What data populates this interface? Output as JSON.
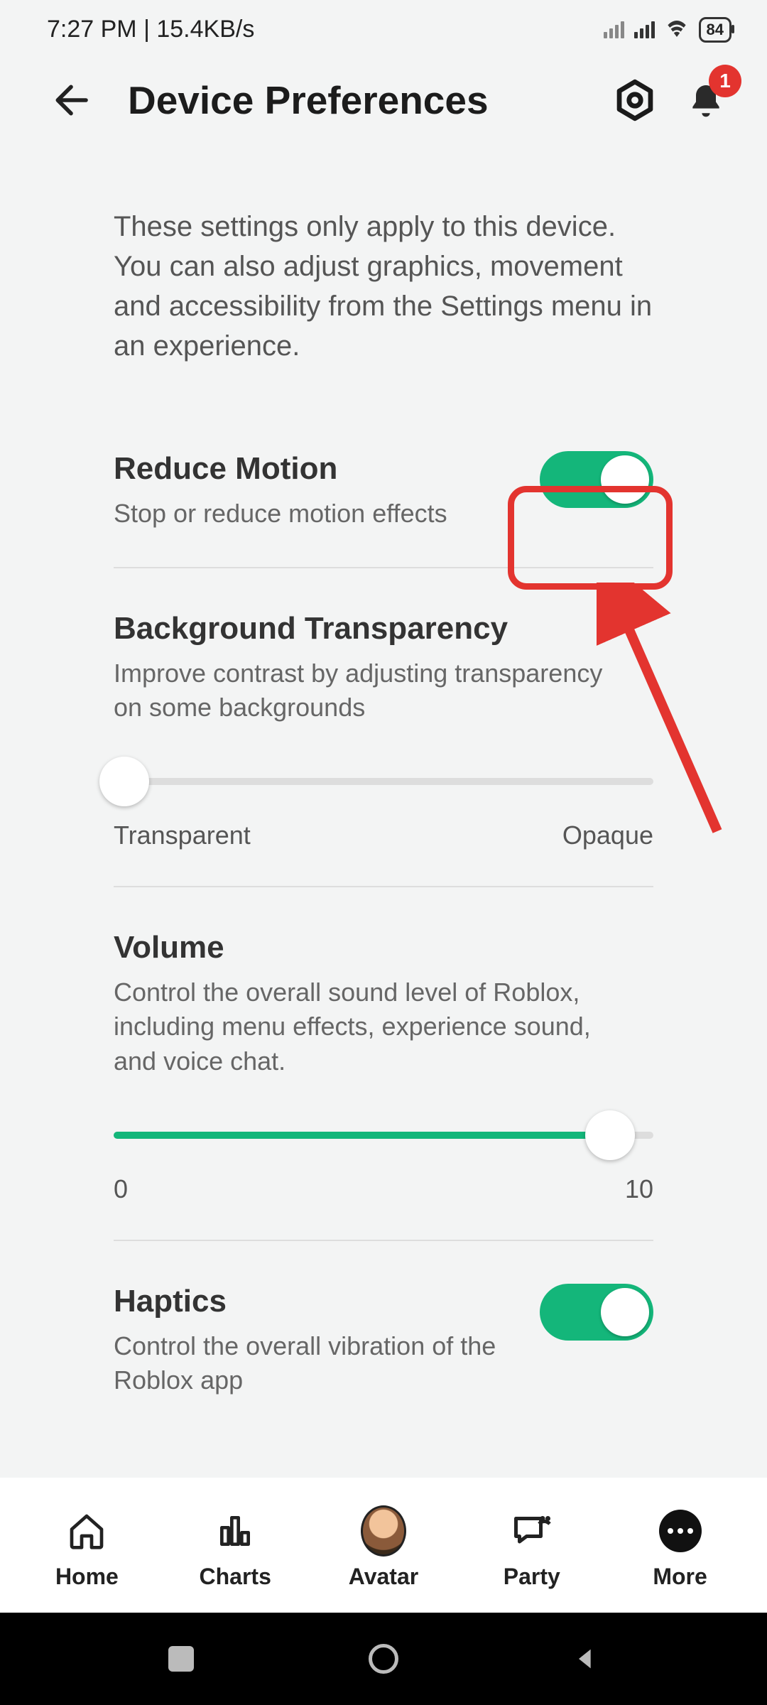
{
  "status": {
    "time": "7:27 PM | 15.4KB/s",
    "battery": "84"
  },
  "header": {
    "title": "Device Preferences",
    "badge": "1"
  },
  "intro": "These settings only apply to this device. You can also adjust graphics, movement and accessibility from the Settings menu in an experience.",
  "reduce_motion": {
    "title": "Reduce Motion",
    "desc": "Stop or reduce motion effects",
    "on": true
  },
  "bg_transparency": {
    "title": "Background Transparency",
    "desc": "Improve contrast by adjusting transparency on some backgrounds",
    "min_label": "Transparent",
    "max_label": "Opaque",
    "value_pct": 0
  },
  "volume": {
    "title": "Volume",
    "desc": "Control the overall sound level of Roblox, including menu effects, experience sound, and voice chat.",
    "min_label": "0",
    "max_label": "10",
    "value_pct": 92
  },
  "haptics": {
    "title": "Haptics",
    "desc": "Control the overall vibration of the Roblox app",
    "on": true
  },
  "nav": {
    "home": "Home",
    "charts": "Charts",
    "avatar": "Avatar",
    "party": "Party",
    "more": "More"
  },
  "annotation": {
    "highlight_target": "reduce-motion-toggle",
    "color": "#e3342f"
  }
}
